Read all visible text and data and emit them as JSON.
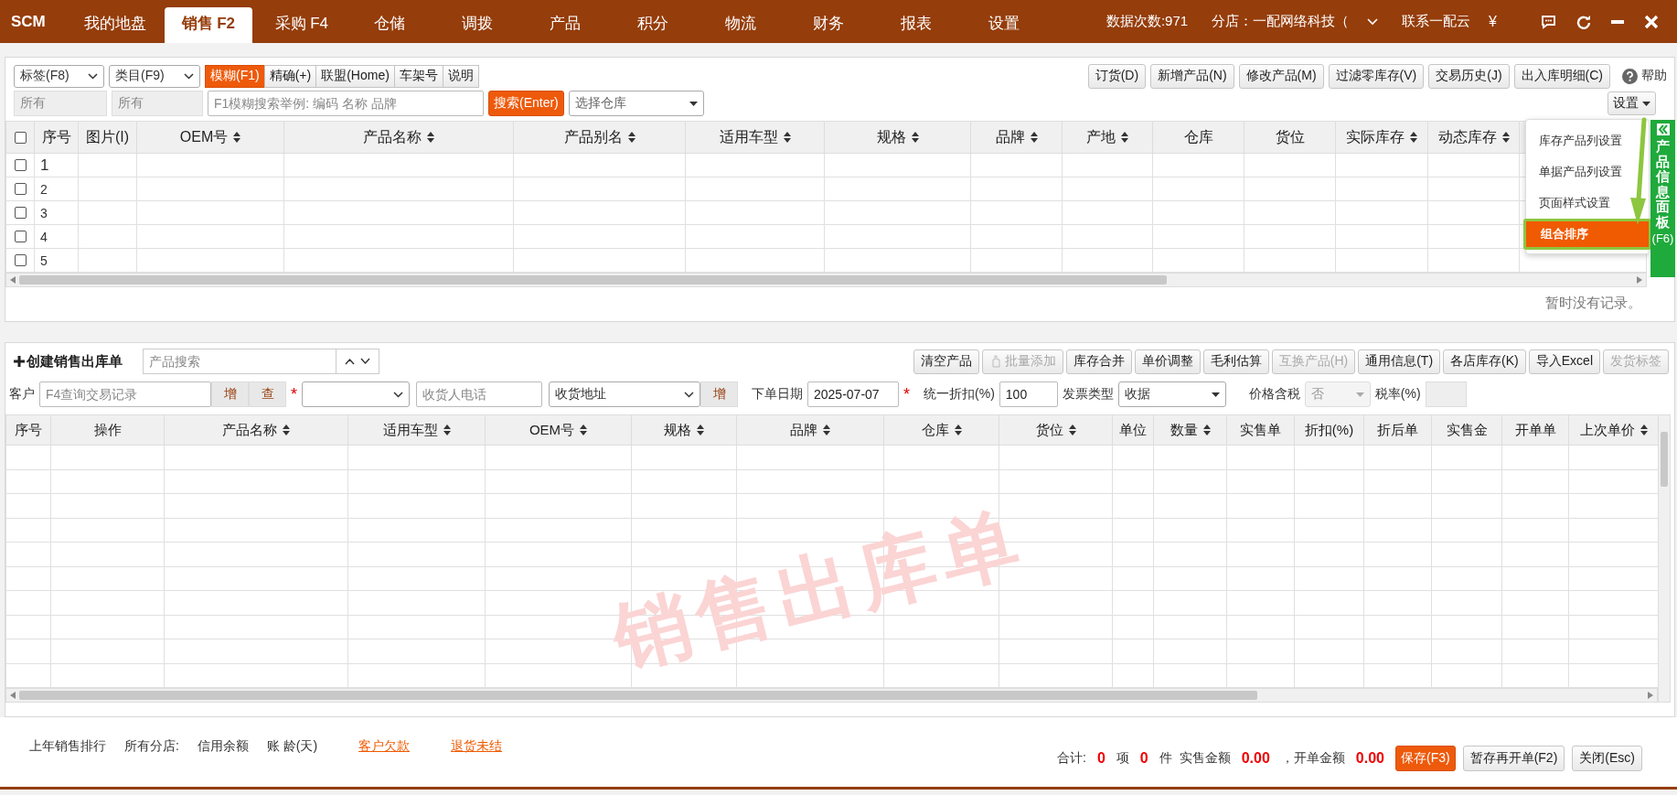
{
  "app": {
    "logo": "SCM"
  },
  "nav_tabs": [
    {
      "label": "我的地盘",
      "selected": false
    },
    {
      "label": "销售 F2",
      "selected": true
    },
    {
      "label": "采购 F4",
      "selected": false
    },
    {
      "label": "仓储",
      "selected": false
    },
    {
      "label": "调拨",
      "selected": false
    },
    {
      "label": "产品",
      "selected": false
    },
    {
      "label": "积分",
      "selected": false
    },
    {
      "label": "物流",
      "selected": false
    },
    {
      "label": "财务",
      "selected": false
    },
    {
      "label": "报表",
      "selected": false
    },
    {
      "label": "设置",
      "selected": false
    }
  ],
  "header": {
    "data_count": "数据次数:971",
    "branch": "分店：一配网络科技（",
    "contact": "联系一配云",
    "currency": "¥"
  },
  "upper": {
    "filters": [
      {
        "label": "标签(F8)",
        "value": "所有"
      },
      {
        "label": "类目(F9)",
        "value": "所有"
      }
    ],
    "search_modes": [
      {
        "label": "模糊(F1)",
        "selected": true
      },
      {
        "label": "精确(+)",
        "selected": false
      },
      {
        "label": "联盟(Home)",
        "selected": false
      },
      {
        "label": "车架号",
        "selected": false
      },
      {
        "label": "说明",
        "selected": false
      }
    ],
    "search_placeholder": "F1模糊搜索举例: 编码 名称 品牌",
    "search_button": "搜索(Enter)",
    "warehouse_placeholder": "选择仓库",
    "actions": [
      "订货(D)",
      "新增产品(N)",
      "修改产品(M)",
      "过滤零库存(V)",
      "交易历史(J)",
      "出入库明细(C)"
    ],
    "help": "帮助",
    "settings_button": "设置",
    "header_checked": false,
    "columns": [
      {
        "label": "序号",
        "sortable": false
      },
      {
        "label": "图片(I)",
        "sortable": false
      },
      {
        "label": "OEM号",
        "sortable": true
      },
      {
        "label": "产品名称",
        "sortable": true
      },
      {
        "label": "产品别名",
        "sortable": true
      },
      {
        "label": "适用车型",
        "sortable": true
      },
      {
        "label": "规格",
        "sortable": true
      },
      {
        "label": "品牌",
        "sortable": true
      },
      {
        "label": "产地",
        "sortable": true
      },
      {
        "label": "仓库",
        "sortable": false
      },
      {
        "label": "货位",
        "sortable": false
      },
      {
        "label": "实际库存",
        "sortable": true
      },
      {
        "label": "动态库存",
        "sortable": true
      }
    ],
    "rows": [
      {
        "number": "1",
        "checked": false
      },
      {
        "number": "2",
        "checked": false
      },
      {
        "number": "3",
        "checked": false
      },
      {
        "number": "4",
        "checked": false
      },
      {
        "number": "5",
        "checked": false
      }
    ],
    "empty_message": "暂时没有记录。"
  },
  "settings_menu": [
    {
      "label": "库存产品列设置",
      "selected": false
    },
    {
      "label": "单据产品列设置",
      "selected": false
    },
    {
      "label": "页面样式设置",
      "selected": false
    },
    {
      "label": "组合排序",
      "selected": true
    }
  ],
  "side_panel": {
    "title": "产品信息面板",
    "shortcut": "(F6)"
  },
  "lower": {
    "title": "创建销售出库单",
    "search_placeholder": "产品搜索",
    "actions": [
      {
        "label": "清空产品",
        "disabled": false
      },
      {
        "label": "批量添加",
        "disabled": true
      },
      {
        "label": "库存合并",
        "disabled": false
      },
      {
        "label": "单价调整",
        "disabled": false
      },
      {
        "label": "毛利估算",
        "disabled": false
      },
      {
        "label": "互换产品(H)",
        "disabled": true
      },
      {
        "label": "通用信息(T)",
        "disabled": false
      },
      {
        "label": "各店库存(K)",
        "disabled": false
      },
      {
        "label": "导入Excel",
        "disabled": false
      },
      {
        "label": "发货标签",
        "disabled": true
      }
    ],
    "form": {
      "customer_label": "客户",
      "customer_placeholder": "F4查询交易记录",
      "add_button": "增",
      "query_button": "查",
      "required_mark": "*",
      "phone_placeholder": "收货人电话",
      "address_value": "收货地址",
      "address_add_button": "增",
      "date_label": "下单日期",
      "date_value": "2025-07-07",
      "date_required_mark": "*",
      "discount_label": "统一折扣(%)",
      "discount_value": "100",
      "invoice_label": "发票类型",
      "invoice_value": "收据",
      "tax_included_label": "价格含税",
      "tax_included_value": "否",
      "tax_rate_label": "税率(%)"
    },
    "columns": [
      {
        "label": "序号",
        "sortable": false
      },
      {
        "label": "操作",
        "sortable": false
      },
      {
        "label": "产品名称",
        "sortable": true
      },
      {
        "label": "适用车型",
        "sortable": true
      },
      {
        "label": "OEM号",
        "sortable": true
      },
      {
        "label": "规格",
        "sortable": true
      },
      {
        "label": "品牌",
        "sortable": true
      },
      {
        "label": "仓库",
        "sortable": true
      },
      {
        "label": "货位",
        "sortable": true
      },
      {
        "label": "单位",
        "sortable": false
      },
      {
        "label": "数量",
        "sortable": true
      },
      {
        "label": "实售单",
        "sortable": false
      },
      {
        "label": "折扣(%)",
        "sortable": false
      },
      {
        "label": "折后单",
        "sortable": false
      },
      {
        "label": "实售金",
        "sortable": false
      },
      {
        "label": "开单单",
        "sortable": false
      },
      {
        "label": "上次单价",
        "sortable": true
      }
    ],
    "watermark": "销售出库单"
  },
  "footer": {
    "labels": [
      "上年销售排行",
      "所有分店:",
      "信用余额",
      "账 龄(天)"
    ],
    "links": [
      "客户欠款",
      "退货未结"
    ],
    "totals": [
      {
        "kind": "label",
        "text": "合计:"
      },
      {
        "kind": "value",
        "text": "0"
      },
      {
        "kind": "label",
        "text": "项"
      },
      {
        "kind": "value",
        "text": "0"
      },
      {
        "kind": "label",
        "text": "件"
      },
      {
        "kind": "label",
        "text": "实售金额"
      },
      {
        "kind": "value",
        "text": "0.00"
      },
      {
        "kind": "label",
        "text": "，开单金额"
      },
      {
        "kind": "value",
        "text": "0.00"
      }
    ],
    "buttons": [
      {
        "label": "保存(F3)",
        "primary": true
      },
      {
        "label": "暂存再开单(F2)",
        "primary": false
      },
      {
        "label": "关闭(Esc)",
        "primary": false
      }
    ]
  }
}
